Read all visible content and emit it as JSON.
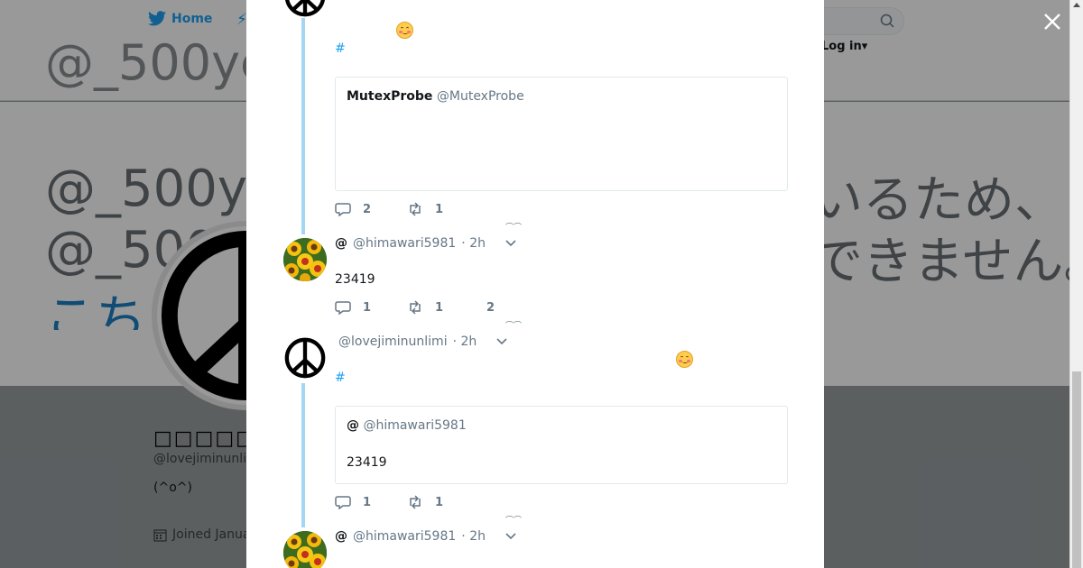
{
  "nav": {
    "home_label": "Home",
    "login_label": "Log in"
  },
  "background": {
    "banner_top_text": "@_500ye",
    "banner_lines": [
      "@_500ye",
      "@_500"
    ],
    "banner_link_text": "こち",
    "banner_right_lines": [
      "いるため、",
      "できません。"
    ],
    "profile_name": "□□□□□",
    "profile_handle": "@lovejiminunli",
    "profile_bio": "(^o^)",
    "profile_joined": "Joined Janua"
  },
  "modal": {
    "tweet1": {
      "hashtag": "#",
      "quote_name": "MutexProbe",
      "quote_handle": "@MutexProbe",
      "reply_count": "2",
      "retweet_count": "1"
    },
    "tweet2": {
      "at_name": "@",
      "handle": "@himawari5981",
      "time": "· 2h",
      "text": "23419",
      "reply_count": "1",
      "retweet_count": "1",
      "like_count": "2"
    },
    "tweet3": {
      "handle": "@lovejiminunlimi",
      "time": "· 2h",
      "hashtag": "#",
      "quote_at_name": "@",
      "quote_handle": "@himawari5981",
      "quote_text": "23419",
      "reply_count": "1",
      "retweet_count": "1"
    },
    "tweet4": {
      "at_name": "@",
      "handle": "@himawari5981",
      "time": "· 2h"
    }
  },
  "icons": {
    "close": "close-icon",
    "reply": "reply-icon",
    "retweet": "retweet-icon",
    "chevron": "chevron-down-icon",
    "emoji": "smiling-face-emoji"
  },
  "colors": {
    "accent": "#1da1f2",
    "thread_line": "#a3d6f5",
    "muted": "#657786"
  }
}
